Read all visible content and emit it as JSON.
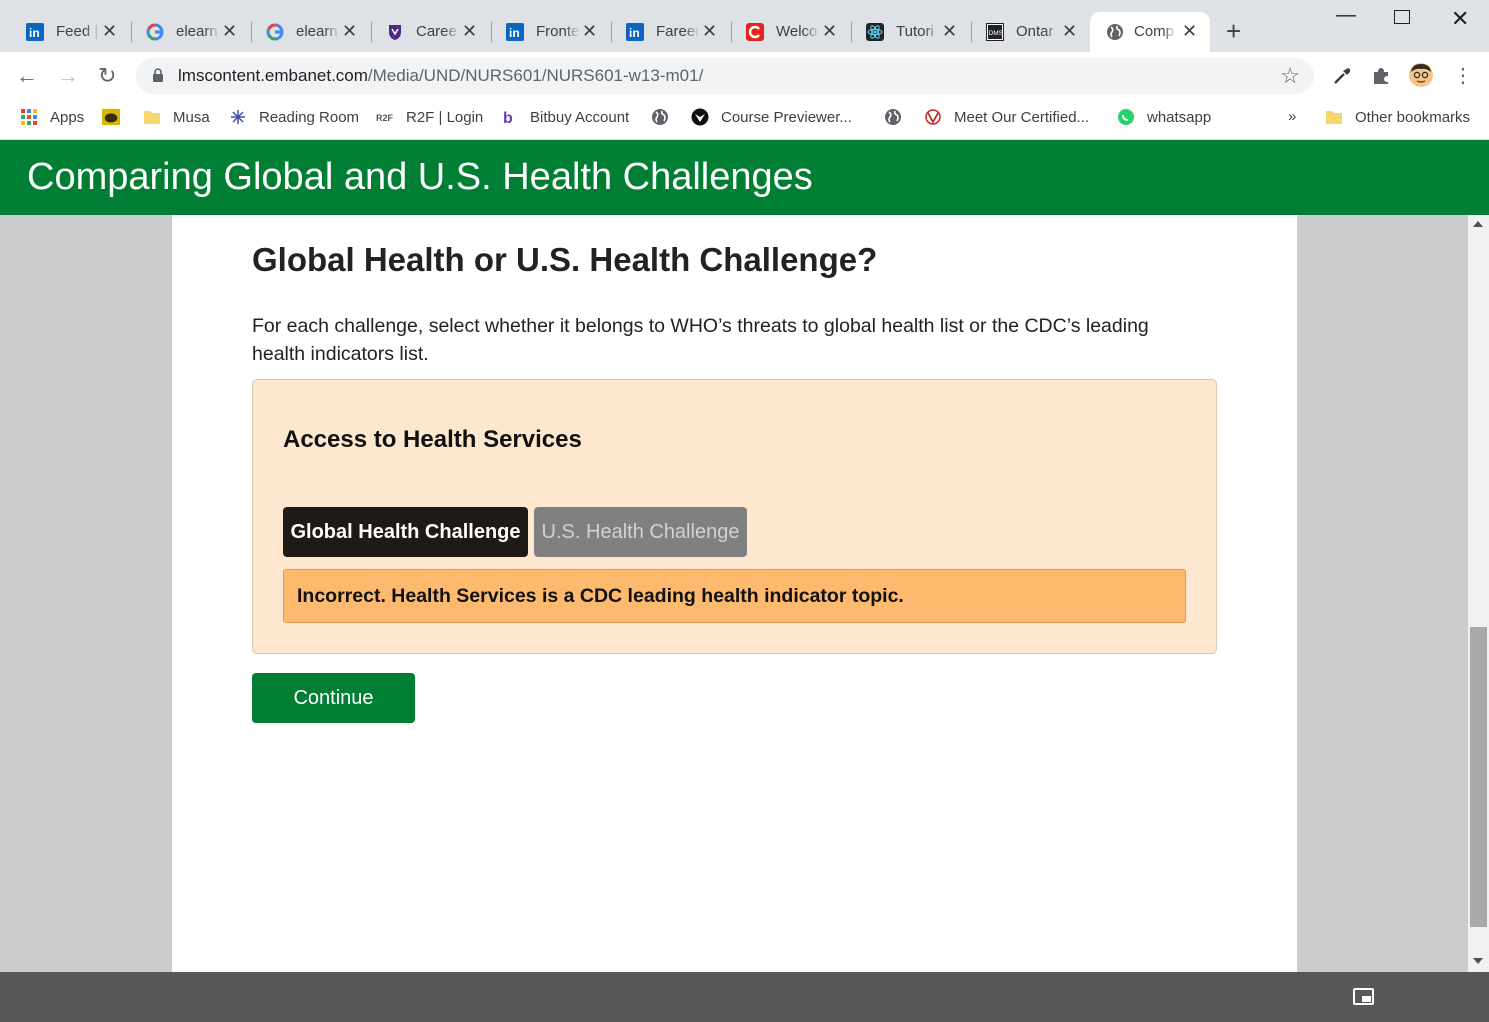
{
  "browser": {
    "tabs": [
      {
        "label": "Feed |",
        "icon": "linkedin-icon"
      },
      {
        "label": "elearn",
        "icon": "google-icon"
      },
      {
        "label": "elearn",
        "icon": "google-icon"
      },
      {
        "label": "Caree",
        "icon": "western-icon"
      },
      {
        "label": "Fronte",
        "icon": "linkedin-icon"
      },
      {
        "label": "Fareed",
        "icon": "linkedin-icon"
      },
      {
        "label": "Welco",
        "icon": "c-red-icon"
      },
      {
        "label": "Tutori",
        "icon": "react-icon"
      },
      {
        "label": "Ontar",
        "icon": "dms-icon"
      },
      {
        "label": "Comp",
        "icon": "globe-icon",
        "active": true
      }
    ],
    "url_host": "lmscontent.embanet.com",
    "url_path": "/Media/UND/NURS601/NURS601-w13-m01/",
    "bookmarks": [
      {
        "label": "Apps",
        "icon": "apps-grid-icon"
      },
      {
        "label": "",
        "icon": "turtle-icon"
      },
      {
        "label": "Musa",
        "icon": "folder-icon"
      },
      {
        "label": "Reading Room",
        "icon": "reading-room-icon"
      },
      {
        "label": "R2F | Login",
        "icon": "r2f-icon"
      },
      {
        "label": "Bitbuy Account",
        "icon": "bitbuy-icon"
      },
      {
        "label": "",
        "icon": "globe-icon"
      },
      {
        "label": "Course Previewer...",
        "icon": "course-icon"
      },
      {
        "label": "",
        "icon": "globe-icon"
      },
      {
        "label": "Meet Our Certified...",
        "icon": "meet-icon"
      },
      {
        "label": "whatsapp",
        "icon": "whatsapp-icon"
      }
    ],
    "bookmarks_overflow": "»",
    "other_bookmarks": "Other bookmarks"
  },
  "page": {
    "header_title": "Comparing Global and U.S. Health Challenges",
    "question_title": "Global Health or U.S. Health Challenge?",
    "instructions": "For each challenge, select whether it belongs to WHO’s threats to global health list or the CDC’s leading health indicators list.",
    "card": {
      "challenge": "Access to Health Services",
      "option_global": "Global Health Challenge",
      "option_us": "U.S. Health Challenge",
      "feedback": "Incorrect. Health Services is a CDC leading health indicator topic."
    },
    "continue_label": "Continue"
  },
  "colors": {
    "brand_green": "#007e34",
    "card_bg": "#fde8cf",
    "feedback_bg": "#fdba6e",
    "selected_btn": "#1f1a17",
    "unselected_btn": "#808080"
  }
}
